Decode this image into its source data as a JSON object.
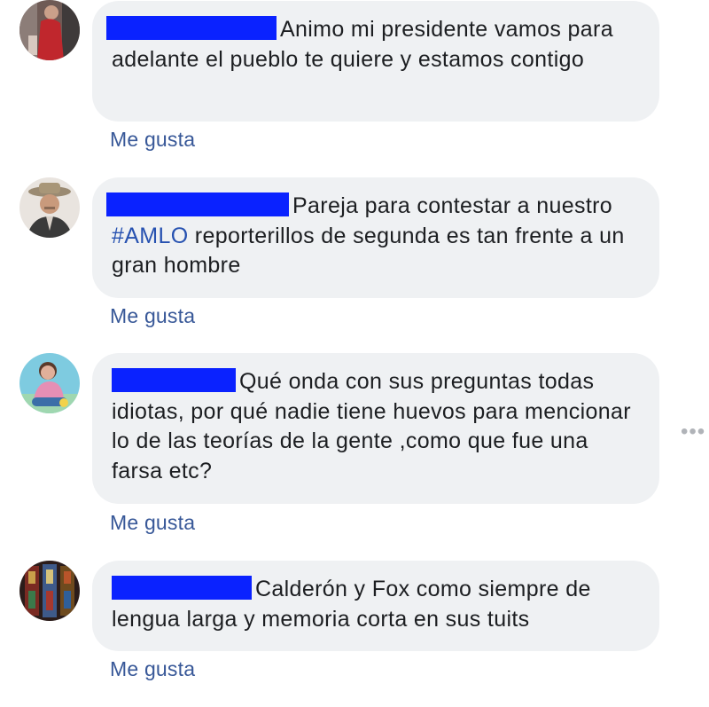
{
  "comments": [
    {
      "text": "Animo mi presidente vamos para adelante el pueblo te quiere y estamos contigo",
      "like_label": "Me gusta",
      "avatar_icon": "profile-photo-woman-red-dress"
    },
    {
      "text_before_hashtag": "Pareja para contestar a nuestro ",
      "hashtag": "#AMLO",
      "text_after_hashtag": " reporterillos de segunda es tan frente a un gran hombre",
      "like_label": "Me gusta",
      "avatar_icon": "profile-photo-man-hat"
    },
    {
      "text": "Qué onda con sus preguntas todas idiotas, por qué nadie tiene huevos para mencionar lo de las teorías de la gente ,como que fue una farsa etc?",
      "like_label": "Me gusta",
      "avatar_icon": "profile-photo-child"
    },
    {
      "text": "Calderón y Fox como siempre de lengua larga y memoria corta en sus tuits",
      "like_label": "Me gusta",
      "avatar_icon": "profile-photo-stained-glass"
    }
  ],
  "more_options_icon": "more-options-dots",
  "colors": {
    "bubble": "#eff1f3",
    "link": "#385898",
    "hashtag": "#2651b0",
    "redaction": "#0a22ff"
  }
}
